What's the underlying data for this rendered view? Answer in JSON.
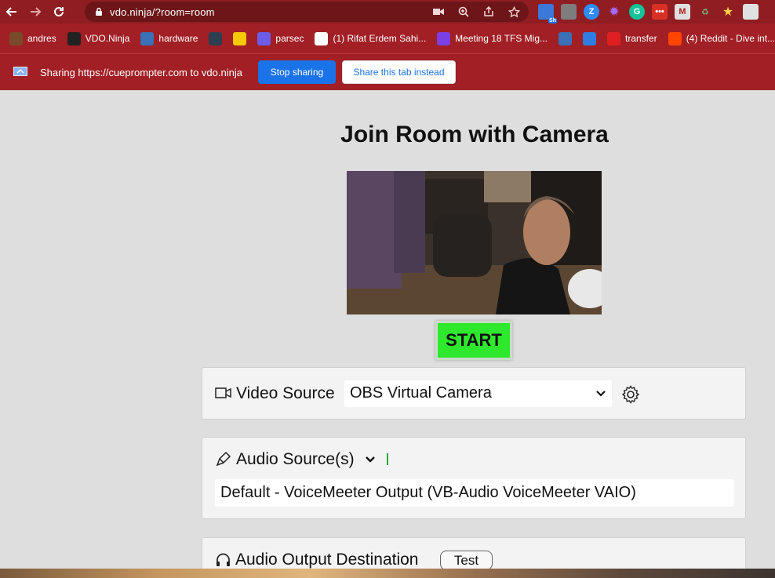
{
  "browser": {
    "url": "vdo.ninja/?room=room",
    "bookmarks": [
      {
        "label": "andres",
        "color": "#7a4b2a"
      },
      {
        "label": "VDO.Ninja",
        "color": "#222222"
      },
      {
        "label": "hardware",
        "color": "#3b6fb6"
      },
      {
        "label": "",
        "color": "#2c3e50"
      },
      {
        "label": "",
        "color": "#f6c900"
      },
      {
        "label": "parsec",
        "color": "#6c5ce7"
      },
      {
        "label": "(1) Rifat Erdem Sahi...",
        "color": "#ffffff"
      },
      {
        "label": "Meeting 18 TFS Mig...",
        "color": "#7b3fe4"
      },
      {
        "label": "",
        "color": "#3b6fb6"
      },
      {
        "label": "",
        "color": "#2f7de1"
      },
      {
        "label": "transfer",
        "color": "#e02020"
      },
      {
        "label": "(4) Reddit - Dive int...",
        "color": "#ff4500"
      }
    ],
    "extension_badge": "Sh"
  },
  "share_bar": {
    "text": "Sharing https://cueprompter.com to vdo.ninja",
    "stop_label": "Stop sharing",
    "share_tab_label": "Share this tab instead"
  },
  "page": {
    "title": "Join Room with Camera",
    "start_label": "START",
    "video_source": {
      "label": "Video Source",
      "selected": "OBS Virtual Camera"
    },
    "audio_source": {
      "label": "Audio Source(s)",
      "device": "Default - VoiceMeeter Output (VB-Audio VoiceMeeter VAIO)"
    },
    "audio_output": {
      "label": "Audio Output Destination",
      "test_label": "Test"
    }
  },
  "colors": {
    "chrome": "#8f1d22",
    "share_bar": "#a11f25",
    "start_button": "#2ee82e",
    "stop_button": "#1a73e8"
  }
}
